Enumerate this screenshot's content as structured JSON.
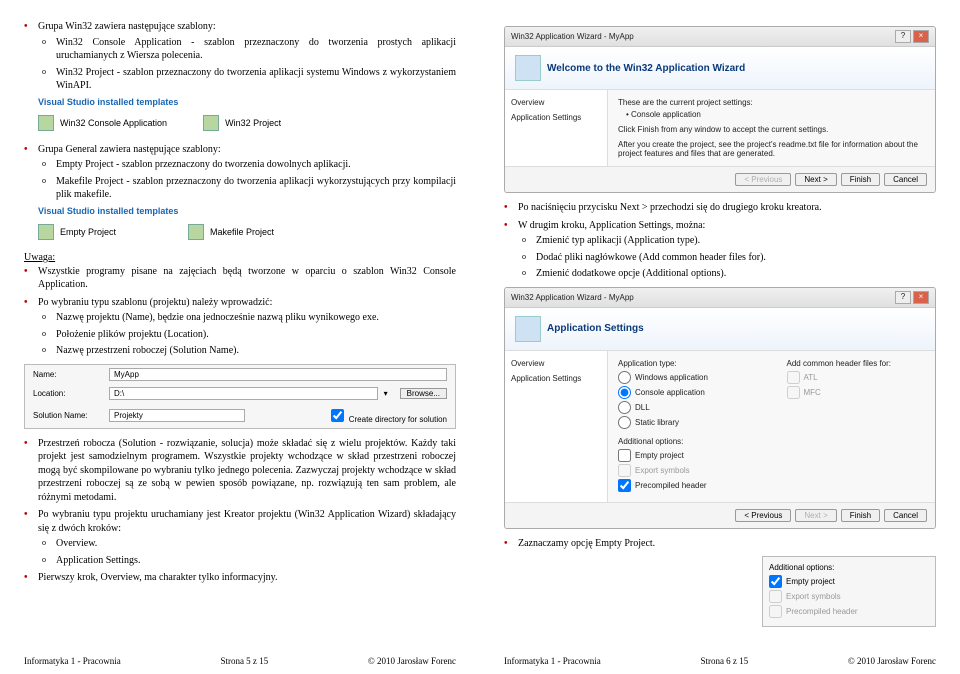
{
  "p1": {
    "h1_1": "Grupa Win32 zawiera następujące szablony:",
    "sub1a": "Win32 Console Application - szablon przeznaczony do tworzenia prostych aplikacji uruchamianych z Wiersza polecenia.",
    "sub1b": "Win32 Project - szablon przeznaczony do tworzenia aplikacji systemu Windows z wykorzystaniem WinAPI.",
    "vtemp": "Visual Studio installed templates",
    "t1": "Win32 Console Application",
    "t2": "Win32 Project",
    "h2": "Grupa General zawiera następujące szablony:",
    "sub2a": "Empty Project - szablon przeznaczony do tworzenia dowolnych aplikacji.",
    "sub2b": "Makefile Project - szablon przeznaczony do tworzenia aplikacji wykorzystujących przy kompilacji plik makefile.",
    "t3": "Empty Project",
    "t4": "Makefile Project",
    "uwaga": "Uwaga:",
    "h3": "Wszystkie programy pisane na zajęciach będą tworzone w oparciu o szablon Win32 Console Application.",
    "h4": "Po wybraniu typu szablonu (projektu) należy wprowadzić:",
    "sub4a": "Nazwę projektu (Name), będzie ona jednocześnie nazwą pliku wynikowego exe.",
    "sub4b": "Położenie plików projektu (Location).",
    "sub4c": "Nazwę przestrzeni roboczej (Solution Name).",
    "np_name": "Name:",
    "np_name_v": "MyApp",
    "np_loc": "Location:",
    "np_loc_v": "D:\\",
    "np_sol": "Solution Name:",
    "np_sol_v": "Projekty",
    "np_browse": "Browse...",
    "np_cb": "Create directory for solution",
    "h5": "Przestrzeń robocza (Solution - rozwiązanie, solucja) może składać się z wielu projektów. Każdy taki projekt jest samodzielnym programem. Wszystkie projekty wchodzące w skład przestrzeni roboczej mogą być skompilowane po wybraniu tylko jednego polecenia. Zazwyczaj projekty wchodzące w skład przestrzeni roboczej są ze sobą w pewien sposób powiązane, np. rozwiązują ten sam problem, ale różnymi metodami.",
    "h6": "Po wybraniu typu projektu uruchamiany jest Kreator projektu (Win32 Application Wizard) składający się z dwóch kroków:",
    "sub6a": "Overview.",
    "sub6b": "Application Settings.",
    "h7": "Pierwszy krok, Overview, ma charakter tylko informacyjny."
  },
  "p2": {
    "wtitle": "Win32 Application Wizard - MyApp",
    "whead": "Welcome to the Win32 Application Wizard",
    "ov": "Overview",
    "as": "Application Settings",
    "txt1": "These are the current project settings:",
    "txt1a": "• Console application",
    "txt2": "Click Finish from any window to accept the current settings.",
    "txt3": "After you create the project, see the project's readme.txt file for information about the project features and files that are generated.",
    "prev": "< Previous",
    "next": "Next >",
    "fin": "Finish",
    "cancel": "Cancel",
    "b1": "Po naciśnięciu przycisku Next > przechodzi się do drugiego kroku kreatora.",
    "b2": "W drugim kroku, Application Settings, można:",
    "sub2a": "Zmienić typ aplikacji (Application type).",
    "sub2b": "Dodać pliki nagłówkowe (Add common header files for).",
    "sub2c": "Zmienić dodatkowe opcje (Additional options).",
    "whead2": "Application Settings",
    "apptype": "Application type:",
    "r_win": "Windows application",
    "r_con": "Console application",
    "r_dll": "DLL",
    "r_static": "Static library",
    "addh": "Add common header files for:",
    "c_atl": "ATL",
    "c_mfc": "MFC",
    "addo": "Additional options:",
    "c_empty": "Empty project",
    "c_exp": "Export symbols",
    "c_pre": "Precompiled header",
    "b3": "Zaznaczamy opcję Empty Project."
  },
  "ft": {
    "l": "Informatyka 1 - Pracownia",
    "c5": "Strona 5 z 15",
    "c6": "Strona 6 z 15",
    "r": "© 2010 Jarosław Forenc"
  }
}
